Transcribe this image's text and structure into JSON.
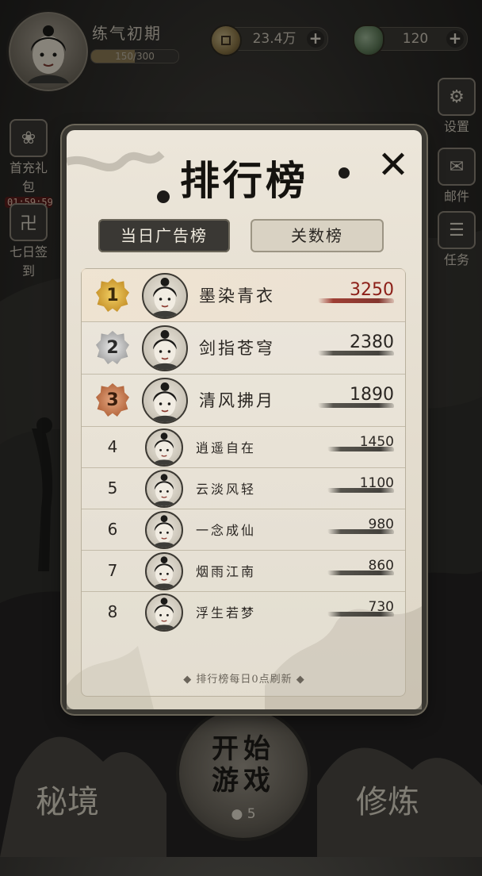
{
  "player": {
    "realm": "练气初期",
    "exp_text": "150/300",
    "exp_progress": 0.5
  },
  "resources": {
    "coins": "23.4万",
    "jade": "120",
    "plus": "+"
  },
  "side_menu": {
    "gift": "首充礼包",
    "gift_timer": "01:59:59",
    "signin": "七日签到",
    "settings": "设置",
    "mail": "邮件",
    "tasks": "任务"
  },
  "bottom_nav": {
    "secret_realm": "秘境",
    "start_line1": "开始",
    "start_line2": "游戏",
    "start_cost": "5",
    "cultivate": "修炼"
  },
  "leaderboard": {
    "title": "排行榜",
    "close": "✕",
    "tabs": [
      {
        "label": "当日广告榜",
        "active": true
      },
      {
        "label": "关数榜",
        "active": false
      }
    ],
    "entries": [
      {
        "rank": "1",
        "name": "墨染青衣",
        "score": "3250"
      },
      {
        "rank": "2",
        "name": "剑指苍穹",
        "score": "2380"
      },
      {
        "rank": "3",
        "name": "清风拂月",
        "score": "1890"
      },
      {
        "rank": "4",
        "name": "逍遥自在",
        "score": "1450"
      },
      {
        "rank": "5",
        "name": "云淡风轻",
        "score": "1100"
      },
      {
        "rank": "6",
        "name": "一念成仙",
        "score": "980"
      },
      {
        "rank": "7",
        "name": "烟雨江南",
        "score": "860"
      },
      {
        "rank": "8",
        "name": "浮生若梦",
        "score": "730"
      }
    ],
    "footnote": "◆ 排行榜每日0点刷新 ◆"
  },
  "colors": {
    "first_place_score": "#8c1f18",
    "ink": "#15130f",
    "paper": "#e8e2d5"
  }
}
